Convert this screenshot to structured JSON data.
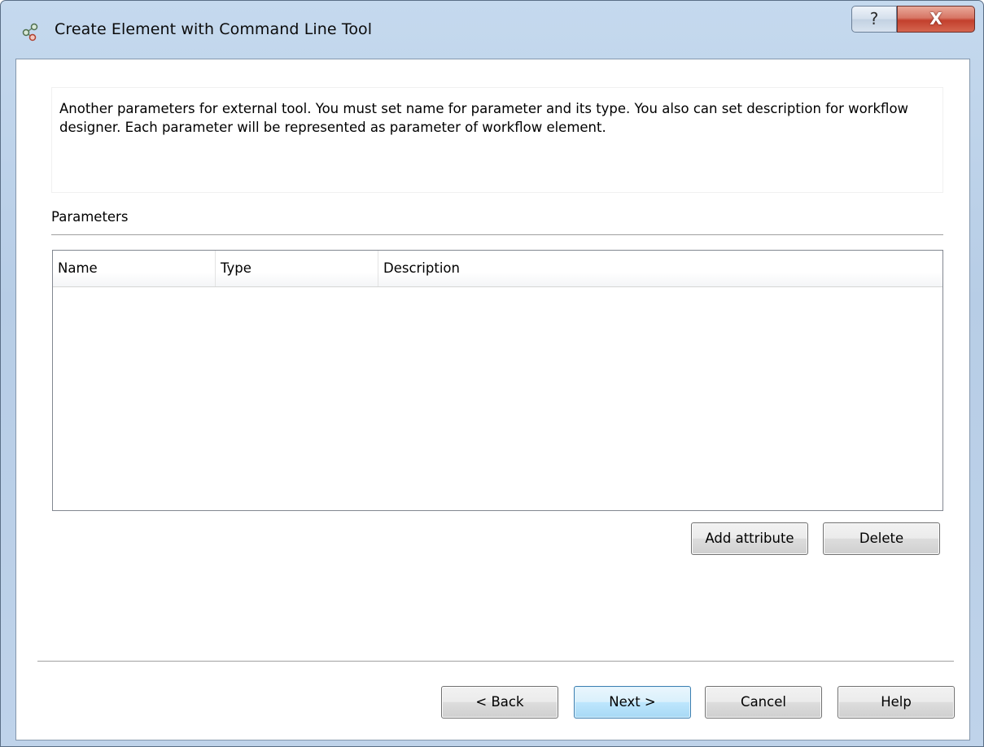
{
  "window": {
    "title": "Create Element with Command Line Tool",
    "icon": "workflow-element-icon",
    "help_symbol": "?",
    "close_symbol": "X"
  },
  "description": "Another parameters for external tool. You must set name for parameter and its type. You also can set description for workflow designer. Each parameter will be represented as  parameter of workflow element.",
  "parameters": {
    "label": "Parameters",
    "columns": [
      "Name",
      "Type",
      "Description"
    ],
    "rows": [],
    "add_label": "Add attribute",
    "delete_label": "Delete"
  },
  "footer": {
    "back_label": "< Back",
    "next_label": "Next >",
    "cancel_label": "Cancel",
    "help_label": "Help"
  },
  "colors": {
    "titlebar": "#bfd3ea",
    "close_button": "#c2402d",
    "default_button_border": "#3c7fb1"
  }
}
